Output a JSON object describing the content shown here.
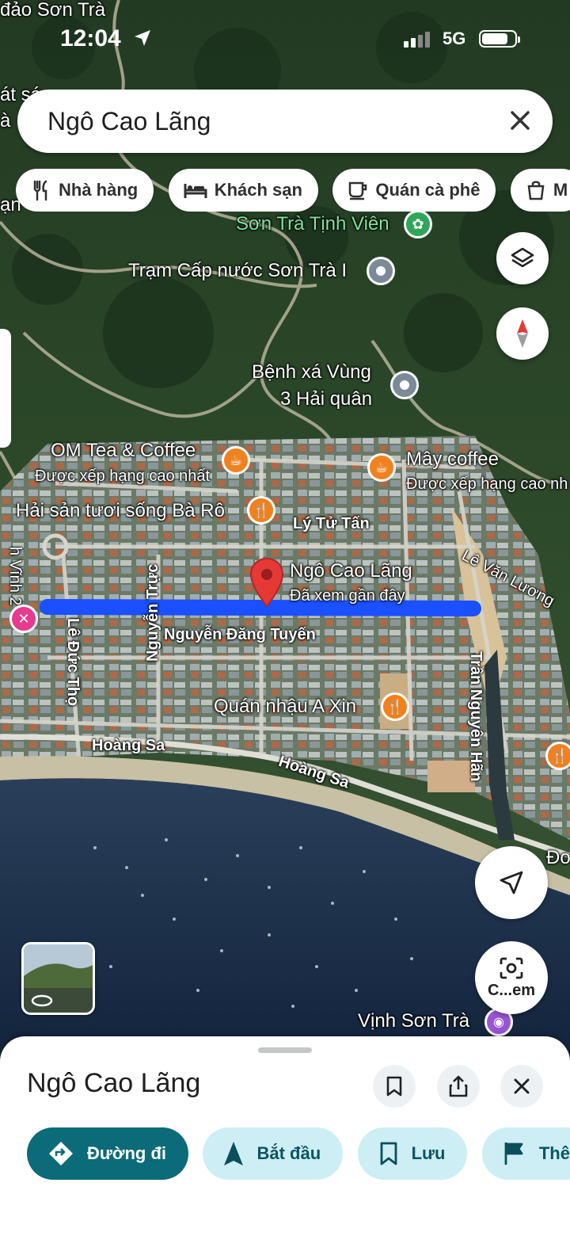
{
  "status_bar": {
    "time": "12:04",
    "network": "5G",
    "battery_level": 0.8
  },
  "search": {
    "query": "Ngô Cao Lãng"
  },
  "chips": [
    {
      "label": "Nhà hàng",
      "icon": "restaurant-icon"
    },
    {
      "label": "Khách sạn",
      "icon": "hotel-icon"
    },
    {
      "label": "Quán cà phê",
      "icon": "coffee-icon"
    },
    {
      "label": "M",
      "icon": "shopping-icon"
    }
  ],
  "map": {
    "places": {
      "top_left": "đảo Sơn Trà",
      "tinh_vien": "Sơn Trà Tịnh Viên",
      "tram_cap_nuoc": "Trạm Cấp nước Sơn Trà I",
      "benh_xa_line1": "Bệnh xá Vùng",
      "benh_xa_line2": "3 Hải quân",
      "om_tea": "OM Tea & Coffee",
      "om_tea_sub": "Được xếp hạng cao nhất",
      "may_coffee": "Mây coffee",
      "may_coffee_sub": "Được xếp hạng cao nh",
      "hai_san": "Hải sản tươi sống Bà Rô",
      "quan_nhau": "Quán nhậu A Xin",
      "vinh_son_tra": "Vịnh Sơn Trà",
      "selected": "Ngô Cao Lãng",
      "selected_sub": "Đã xem gần đây",
      "edge_left_top1": "át sá",
      "edge_left_top2": "à",
      "edge_left_mid": "ạn",
      "edge_right": "Đo"
    },
    "streets": {
      "ly_tu_tan": "Lý Tử Tấn",
      "le_van_luong": "Lê Văn Lương",
      "nguyen_truc": "Nguyễn Trực",
      "le_duc_tho": "Lê Đức Thọ",
      "nguyen_dang_tuyen": "Nguyễn Đăng Tuyến",
      "hoang_sa_1": "Hoàng Sa",
      "hoang_sa_2": "Hoàng Sa",
      "tran_nguyen_han": "Trần Nguyên Hãn",
      "vinh_2": "h Vĩnh 2"
    },
    "camera_label": "C...em",
    "highlight_color": "#1a50ff",
    "pin_color": "#e53935"
  },
  "sheet": {
    "title": "Ngô Cao Lãng",
    "actions": [
      {
        "label": "Đường đi",
        "icon": "directions-icon"
      },
      {
        "label": "Bắt đầu",
        "icon": "navigation-icon"
      },
      {
        "label": "Lưu",
        "icon": "bookmark-icon"
      },
      {
        "label": "Thê",
        "icon": "flag-icon"
      }
    ]
  }
}
